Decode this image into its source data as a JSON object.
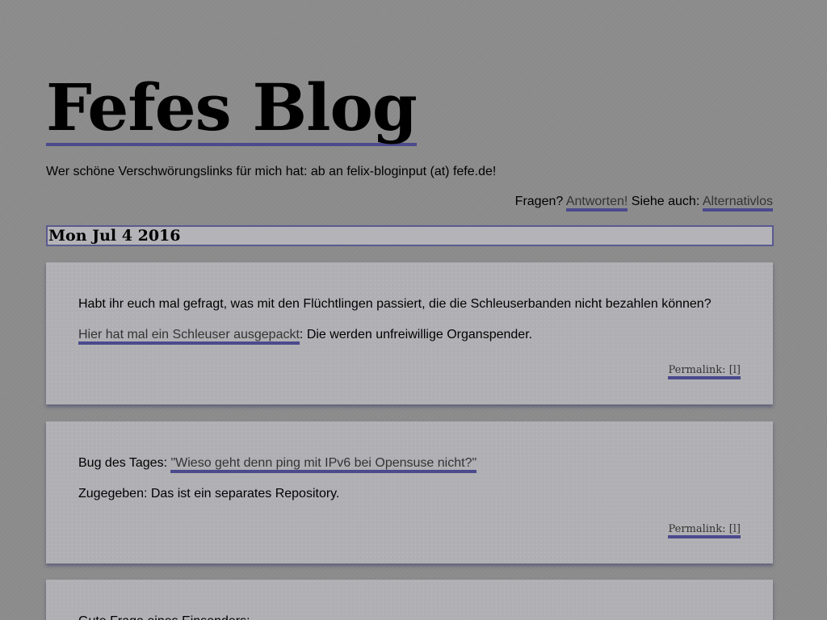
{
  "site": {
    "title": "Fefes Blog",
    "tagline": "Wer schöne Verschwörungslinks für mich hat: ab an felix-bloginput (at) fefe.de!"
  },
  "topnav": {
    "questions_text": "Fragen?",
    "answers_link": "Antworten!",
    "see_also_text": "Siehe auch:",
    "alternative_link": "Alternativlos"
  },
  "day": {
    "date": "Mon Jul 4 2016"
  },
  "posts": [
    {
      "line1": "Habt ihr euch mal gefragt, was mit den Flüchtlingen passiert, die die Schleuserbanden nicht bezahlen können?",
      "link_text": "Hier hat mal ein Schleuser ausgepackt",
      "line2_rest": ": Die werden unfreiwillige Organspender.",
      "permalink": "Permalink: [l]"
    },
    {
      "line1_prefix": "Bug des Tages: ",
      "link_text": "\"Wieso geht denn ping mit IPv6 bei Opensuse nicht?\"",
      "line2": "Zugegeben: Das ist ein separates Repository.",
      "permalink": "Permalink: [l]"
    },
    {
      "line1": "Gute Frage eines Einsenders:"
    }
  ],
  "colors": {
    "background": "#8c8c8c",
    "post_background": "#b0b0b4",
    "link_underline": "#4b4a8c"
  }
}
